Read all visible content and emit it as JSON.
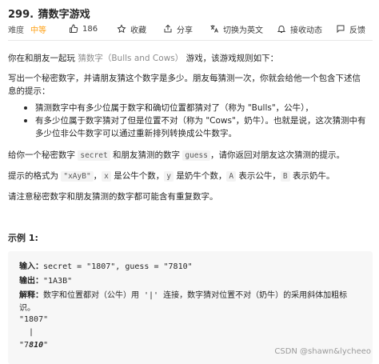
{
  "header": {
    "number": "299.",
    "title": "猜数字游戏"
  },
  "meta": {
    "difficulty_label": "难度",
    "difficulty": "中等",
    "likes": "186",
    "favorite": "收藏",
    "share": "分享",
    "switch_lang": "切换为英文",
    "notify": "接收动态",
    "feedback": "反馈"
  },
  "description": {
    "intro_before": "你在和朋友一起玩 ",
    "intro_link": "猜数字（Bulls and Cows）",
    "intro_after": "游戏，该游戏规则如下：",
    "para1_line1": "写出一个秘密数字，并请朋友猜这个数字是多少。朋友每猜测一次，你就会给他一个包含下述信",
    "para1_line2": "息的提示：",
    "bullets": [
      {
        "line1": "猜测数字中有多少位属于数字和确切位置都猜对了（称为 \"Bulls\"，公牛），",
        "line2": ""
      },
      {
        "line1": "有多少位属于数字猜对了但是位置不对（称为 \"Cows\"，奶牛）。也就是说，这次猜测中有",
        "line2": "多少位非公牛数字可以通过重新排列转换成公牛数字。"
      }
    ],
    "para2_before": "给你一个秘密数字 ",
    "para2_code1": "secret",
    "para2_mid": " 和朋友猜测的数字 ",
    "para2_code2": "guess",
    "para2_after": "，请你返回对朋友这次猜测的提示。",
    "para3_before": "提示的格式为 ",
    "para3_code1": "\"xAyB\"",
    "para3_t1": "，",
    "para3_code2": "x",
    "para3_t2": " 是公牛个数，",
    "para3_code3": "y",
    "para3_t3": " 是奶牛个数，",
    "para3_code4": "A",
    "para3_t4": " 表示公牛，",
    "para3_code5": "B",
    "para3_t5": " 表示奶牛。",
    "para4": "请注意秘密数字和朋友猜测的数字都可能含有重复数字。"
  },
  "example": {
    "title": "示例 1:",
    "input_label": "输入：",
    "input_value": "secret = \"1807\", guess = \"7810\"",
    "output_label": "输出：",
    "output_value": "\"1A3B\"",
    "explain_label": "解释：",
    "explain_line1": "数字和位置都对（公牛）用 '|' 连接，数字猜对位置不对（奶牛）的采用斜体加粗标",
    "explain_line2": "识。",
    "code_line1": "\"1807\"",
    "code_line2": "  |",
    "code_line3_quote_open": "\"",
    "code_line3_plain": "7",
    "code_line3_bi": "810",
    "code_line3_quote_close": "\""
  },
  "watermark": "CSDN @shawn&lycheeo",
  "colors": {
    "difficulty": "#ffa116",
    "link": "#8c8c8c",
    "code_bg": "#f3f3f3",
    "example_bg": "#f7f7f7"
  }
}
